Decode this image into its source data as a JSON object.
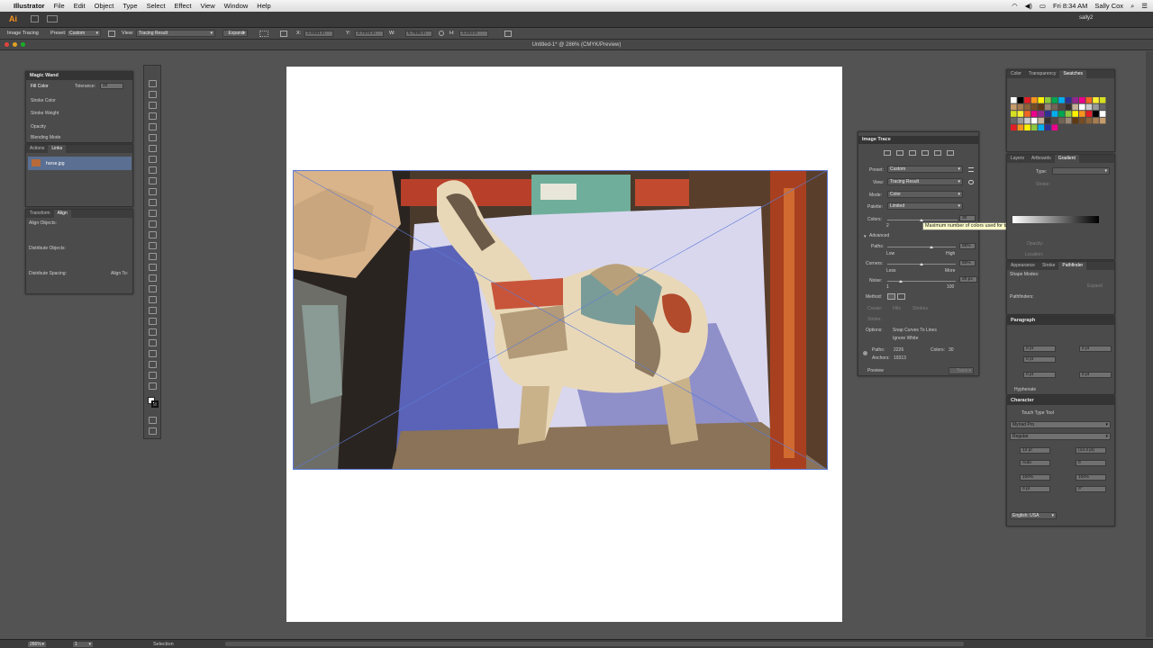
{
  "menubar": {
    "apple": "",
    "app": "Illustrator",
    "items": [
      "File",
      "Edit",
      "Object",
      "Type",
      "Select",
      "Effect",
      "View",
      "Window",
      "Help"
    ],
    "clock": "Fri 8:34 AM",
    "user": "Sally Cox"
  },
  "appbar": {
    "logo": "Ai",
    "user": "sally2"
  },
  "control": {
    "mode": "Image Tracing",
    "preset_label": "Preset:",
    "preset_value": "Custom",
    "view_label": "View:",
    "view_value": "Tracing Result",
    "expand": "Expand",
    "x_label": "X:",
    "x": "2.9481 in",
    "y_label": "Y:",
    "y": "2.7374 in",
    "w_label": "W:",
    "w": "5.7699 in",
    "h_label": "H:",
    "h": "3.244 in"
  },
  "document": {
    "title": "Untitled-1* @ 286% (CMYK/Preview)"
  },
  "magic_wand": {
    "title": "Magic Wand",
    "fill_color": "Fill Color",
    "tolerance_label": "Tolerance:",
    "tolerance": "20",
    "stroke_color": "Stroke Color",
    "stroke_weight": "Stroke Weight",
    "opacity": "Opacity",
    "blending_mode": "Blending Mode",
    "tol_dim": "Tolerance:"
  },
  "links": {
    "tabs": [
      "Actions",
      "Links"
    ],
    "file": "horse.jpg"
  },
  "align": {
    "tabs": [
      "Transform",
      "Align"
    ],
    "align_objects": "Align Objects:",
    "distribute_objects": "Distribute Objects:",
    "distribute_spacing": "Distribute Spacing:",
    "align_to": "Align To:"
  },
  "image_trace": {
    "title": "Image Trace",
    "preset_label": "Preset:",
    "preset": "Custom",
    "view_label": "View:",
    "view": "Tracing Result",
    "mode_label": "Mode:",
    "mode": "Color",
    "palette_label": "Palette:",
    "palette": "Limited",
    "colors_label": "Colors:",
    "colors": "30",
    "colors_min": "2",
    "advanced": "Advanced",
    "paths_label": "Paths:",
    "paths": "65%",
    "paths_low": "Low",
    "paths_high": "High",
    "corners_label": "Corners:",
    "corners": "50%",
    "corners_less": "Less",
    "corners_more": "More",
    "noise_label": "Noise:",
    "noise": "20 px",
    "noise_min": "1",
    "noise_max": "100",
    "method_label": "Method:",
    "create_label": "Create:",
    "fills": "Fills",
    "strokes": "Strokes",
    "stroke_label": "Stroke:",
    "options_label": "Options:",
    "snap": "Snap Curves To Lines",
    "ignore_white": "Ignore White",
    "paths_count_label": "Paths:",
    "paths_count": "2226",
    "colors_count_label": "Colors:",
    "colors_count": "30",
    "anchors_label": "Anchors:",
    "anchors": "19313",
    "preview": "Preview",
    "trace_button": "Trace",
    "tooltip": "Maximum number of colors used for tracing"
  },
  "swatches": {
    "tabs": [
      "Color",
      "Transparency",
      "Swatches"
    ]
  },
  "gradient": {
    "tabs": [
      "Layers",
      "Artboards",
      "Gradient"
    ],
    "type_label": "Type:",
    "stroke_label": "Stroke:",
    "opacity_label": "Opacity:",
    "location_label": "Location:"
  },
  "pathfinder": {
    "tabs": [
      "Appearance",
      "Stroke",
      "Pathfinder"
    ],
    "shape_modes": "Shape Modes:",
    "pathfinders": "Pathfinders:",
    "expand": "Expand"
  },
  "paragraph": {
    "title": "Paragraph",
    "v1": "0 pt",
    "v2": "0 pt",
    "v3": "0 pt",
    "v4": "0 pt",
    "v5": "0 pt",
    "hyphenate": "Hyphenate"
  },
  "character": {
    "title": "Character",
    "touch_type": "Touch Type Tool",
    "font": "Myriad Pro",
    "style": "Regular",
    "size": "12 pt",
    "leading": "(14.4 pt)",
    "kerning": "Auto",
    "tracking": "0",
    "vscale": "100%",
    "hscale": "100%",
    "baseline": "0 pt",
    "rotate": "0°",
    "language": "English: USA"
  },
  "status": {
    "zoom": "286%",
    "page": "1",
    "tool": "Selection"
  },
  "colors": {
    "accent": "#4a6fbf",
    "panel": "#4b4b4b",
    "tooltip": "#ffffcc"
  }
}
